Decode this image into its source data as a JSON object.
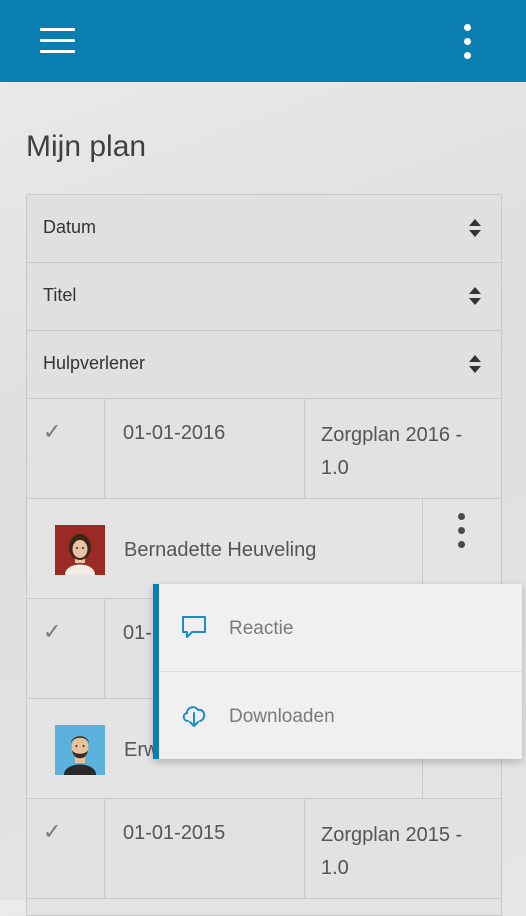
{
  "appbar": {
    "menu_icon": "hamburger-icon",
    "more_icon": "more-vertical-icon",
    "color": "#0a7eb1"
  },
  "page": {
    "title": "Mijn plan"
  },
  "sort_fields": [
    {
      "label": "Datum",
      "icon": "sort-icon"
    },
    {
      "label": "Titel",
      "icon": "sort-icon"
    },
    {
      "label": "Hulpverlener",
      "icon": "sort-icon"
    }
  ],
  "plans": [
    {
      "checked": "✓",
      "date": "01-01-2016",
      "title": "Zorgplan 2016 - 1.0",
      "hulpverlener": "Bernadette Heuveling"
    },
    {
      "checked": "✓",
      "date": "01-",
      "title": "",
      "hulpverlener": "Erw"
    },
    {
      "checked": "✓",
      "date": "01-01-2015",
      "title": "Zorgplan 2015 - 1.0",
      "hulpverlener": ""
    }
  ],
  "context_menu": {
    "items": [
      {
        "label": "Reactie",
        "icon": "comment-icon"
      },
      {
        "label": "Downloaden",
        "icon": "cloud-download-icon"
      }
    ]
  }
}
